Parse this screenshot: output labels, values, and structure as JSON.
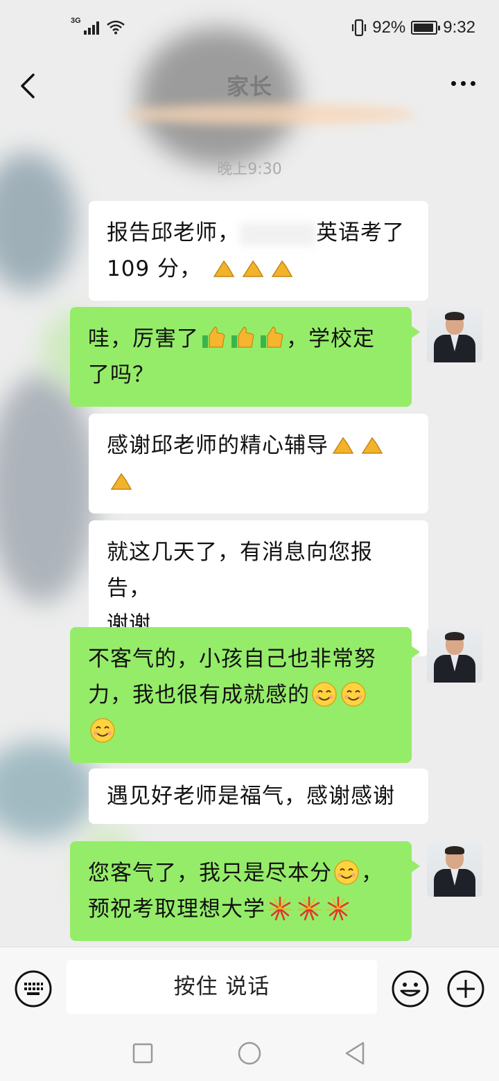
{
  "status_bar": {
    "network": "3G",
    "battery": "92%",
    "battery_level": 0.92,
    "time": "9:32"
  },
  "header": {
    "title": "家长",
    "back_icon": "chevron-left-icon",
    "more_icon": "more-dots-icon"
  },
  "chat": {
    "timestamp": "晚上9:30",
    "messages": [
      {
        "side": "left",
        "line1": "报告邱老师，",
        "line1b": "英语考了",
        "line2": "109 分，"
      },
      {
        "side": "right",
        "line1a": "哇，厉害了",
        "line1b": "，学校定",
        "line2": "了吗？"
      },
      {
        "side": "left",
        "line1": "感谢邱老师的精心辅导"
      },
      {
        "side": "left",
        "line1": "就这几天了，有消息向您报告，",
        "line2": "谢谢"
      },
      {
        "side": "right",
        "line1": "不客气的，小孩自己也非常努",
        "line2": "力，我也很有成就感的"
      },
      {
        "side": "left",
        "line1": "遇见好老师是福气，感谢感谢"
      },
      {
        "side": "right",
        "line1a": "您客气了，我只是尽本分",
        "line1b": "，",
        "line2": "预祝考取理想大学"
      }
    ]
  },
  "input_bar": {
    "voice_button_label": "按住 说话",
    "keyboard_icon": "keyboard-icon",
    "emoji_icon": "smiley-icon",
    "add_icon": "plus-circle-icon"
  },
  "colors": {
    "bubble_self": "#95ec69",
    "bubble_other": "#ffffff",
    "background": "#ededed"
  }
}
